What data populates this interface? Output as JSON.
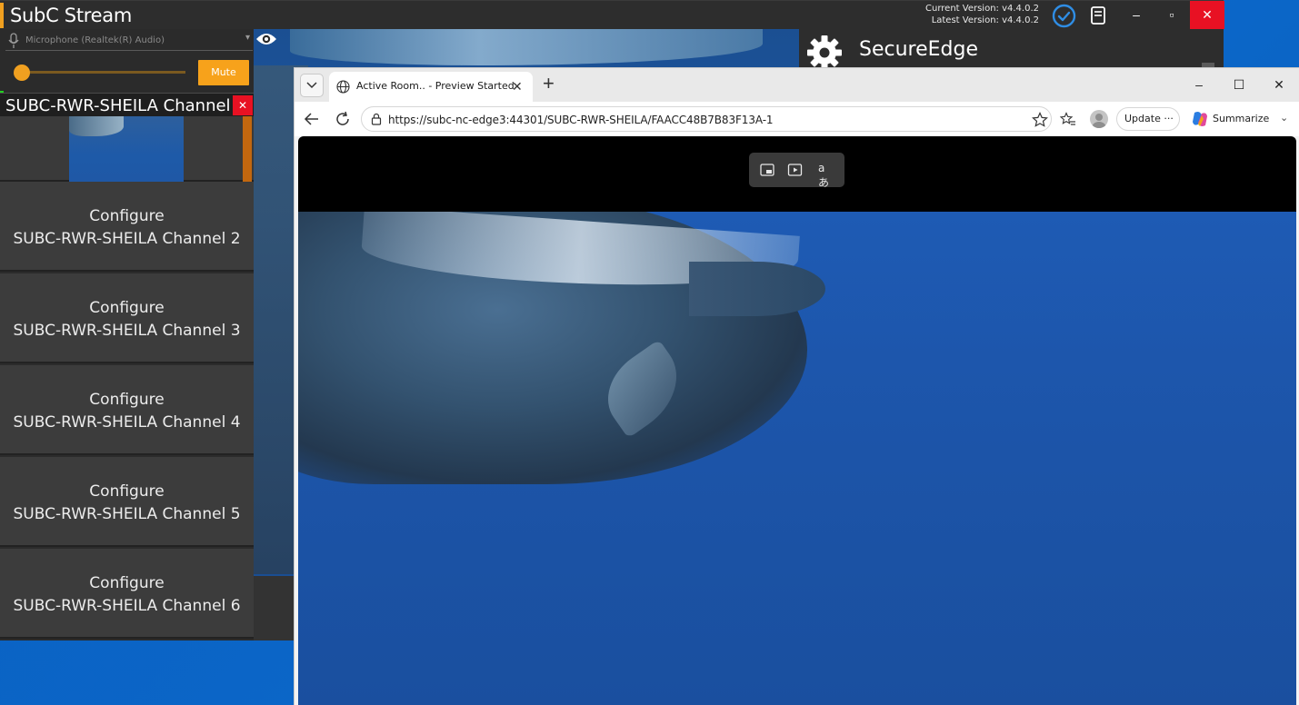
{
  "subc": {
    "title": "SubC Stream",
    "current_version": "Current Version: v4.4.0.2",
    "latest_version": "Latest Version: v4.4.0.2",
    "min_label": "–",
    "max_label": "▫",
    "close_label": "✕",
    "microphone_label": "Microphone (Realtek(R) Audio)",
    "mute_label": "Mute",
    "volume_level": 0.0,
    "channel1_title": "SUBC-RWR-SHEILA Channel 1",
    "channel1_close": "✕",
    "config_buttons": [
      {
        "line1": "Configure",
        "line2": "SUBC-RWR-SHEILA Channel 2"
      },
      {
        "line1": "Configure",
        "line2": "SUBC-RWR-SHEILA Channel 3"
      },
      {
        "line1": "Configure",
        "line2": "SUBC-RWR-SHEILA Channel 4"
      },
      {
        "line1": "Configure",
        "line2": "SUBC-RWR-SHEILA Channel 5"
      },
      {
        "line1": "Configure",
        "line2": "SUBC-RWR-SHEILA Channel 6"
      }
    ],
    "secure_edge_title": "SecureEdge",
    "accent_color": "#f7a21b"
  },
  "browser": {
    "tab_title": "Active Room.. - Preview Started",
    "tab_close": "✕",
    "new_tab": "+",
    "url": "https://subc-nc-edge3:44301/SUBC-RWR-SHEILA/FAACC48B7B83F13A-1",
    "update_label": "Update ···",
    "summarize_label": "Summarize",
    "summarize_caret": "⌄",
    "win_min": "–",
    "win_max": "☐",
    "win_close": "✕",
    "translate_label": "aあ"
  }
}
